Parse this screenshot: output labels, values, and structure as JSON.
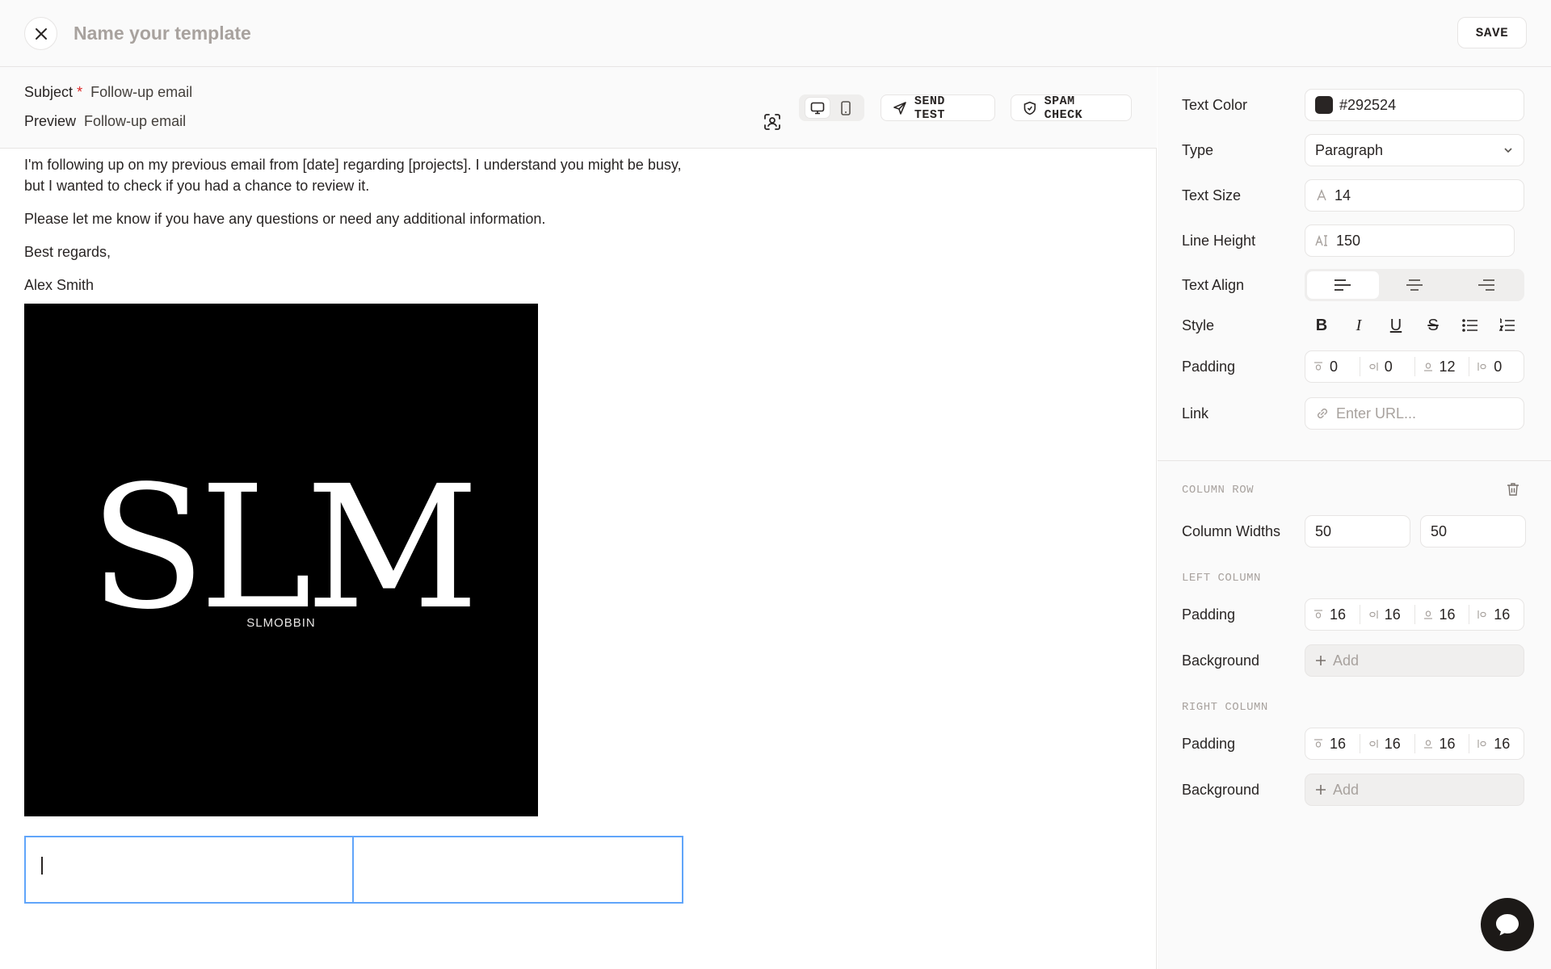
{
  "header": {
    "name_placeholder": "Name your template",
    "save_label": "SAVE"
  },
  "meta": {
    "subject_label": "Subject",
    "subject_required": "*",
    "subject_value": "Follow-up email",
    "preview_label": "Preview",
    "preview_value": "Follow-up email"
  },
  "toolbar": {
    "send_test_label": "SEND TEST",
    "spam_check_label": "SPAM CHECK"
  },
  "content": {
    "paragraphs": [
      "I'm following up on my previous email from [date] regarding [projects]. I understand you might be busy, but I wanted to check if you had a chance to review it.",
      "Please let me know if you have any questions or need any additional information.",
      "Best regards,",
      "Alex Smith"
    ],
    "logo_text": "SLM",
    "logo_subtext": "SLMOBBIN"
  },
  "panel": {
    "text_color_label": "Text Color",
    "text_color_value": "#292524",
    "type_label": "Type",
    "type_value": "Paragraph",
    "text_size_label": "Text Size",
    "text_size_value": "14",
    "line_height_label": "Line Height",
    "line_height_value": "150",
    "text_align_label": "Text Align",
    "style_label": "Style",
    "padding_label": "Padding",
    "padding_values": [
      "0",
      "0",
      "12",
      "0"
    ],
    "link_label": "Link",
    "link_placeholder": "Enter URL...",
    "column_row_title": "COLUMN ROW",
    "column_widths_label": "Column Widths",
    "column_widths": [
      "50",
      "50"
    ],
    "left_column_title": "LEFT COLUMN",
    "left_padding_label": "Padding",
    "left_padding_values": [
      "16",
      "16",
      "16",
      "16"
    ],
    "left_background_label": "Background",
    "left_background_add": "Add",
    "right_column_title": "RIGHT COLUMN",
    "right_padding_label": "Padding",
    "right_padding_values": [
      "16",
      "16",
      "16",
      "16"
    ],
    "right_background_label": "Background",
    "right_background_add": "Add"
  },
  "colors": {
    "text": "#292524",
    "muted": "#a8a29e",
    "border": "#e7e5e4",
    "selection": "#60a5fa"
  }
}
